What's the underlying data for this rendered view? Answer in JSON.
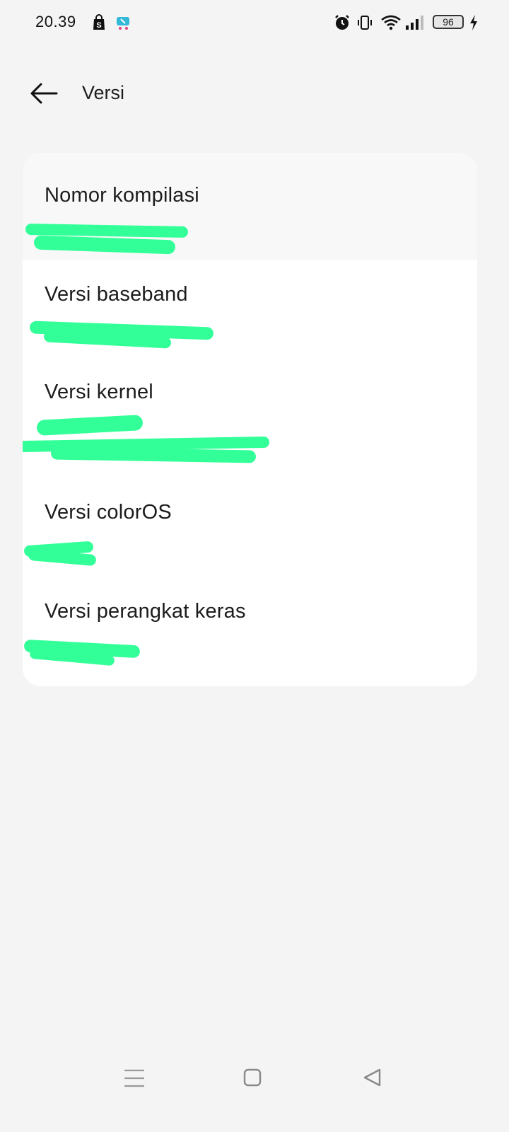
{
  "status_bar": {
    "time": "20.39",
    "battery_level": "96",
    "icons": [
      "shopee-bag-icon",
      "cart-notification-icon",
      "alarm-icon",
      "vibrate-icon",
      "wifi-icon",
      "signal-icon",
      "battery-icon",
      "charging-icon"
    ]
  },
  "header": {
    "title": "Versi",
    "back_icon": "arrow-left-icon"
  },
  "version_list": [
    {
      "label": "Nomor kompilasi",
      "value": ""
    },
    {
      "label": "Versi baseband",
      "value": ""
    },
    {
      "label": "Versi kernel",
      "value": ""
    },
    {
      "label": "Versi colorOS",
      "value": ""
    },
    {
      "label": "Versi perangkat keras",
      "value": ""
    }
  ],
  "nav_bar": {
    "icons": [
      "menu-icon",
      "home-icon",
      "back-triangle-icon"
    ]
  },
  "colors": {
    "background": "#f4f4f4",
    "card": "#ffffff",
    "redaction": "#33ff99"
  }
}
